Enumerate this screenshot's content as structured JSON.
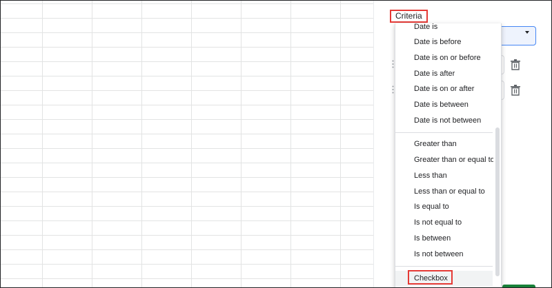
{
  "criteria": {
    "label": "Criteria"
  },
  "menu": {
    "date_items": [
      "Date is",
      "Date is before",
      "Date is on or before",
      "Date is after",
      "Date is on or after",
      "Date is between",
      "Date is not between"
    ],
    "number_items": [
      "Greater than",
      "Greater than or equal to",
      "Less than",
      "Less than or equal to",
      "Is equal to",
      "Is not equal to",
      "Is between",
      "Is not between"
    ],
    "checkbox_item": "Checkbox"
  },
  "icons": {
    "delete": "trash-icon",
    "dropdown": "caret-down-icon",
    "drag": "drag-handle-icon"
  },
  "colors": {
    "highlight": "#e53935",
    "accent": "#4285f4",
    "confirm": "#188038"
  }
}
